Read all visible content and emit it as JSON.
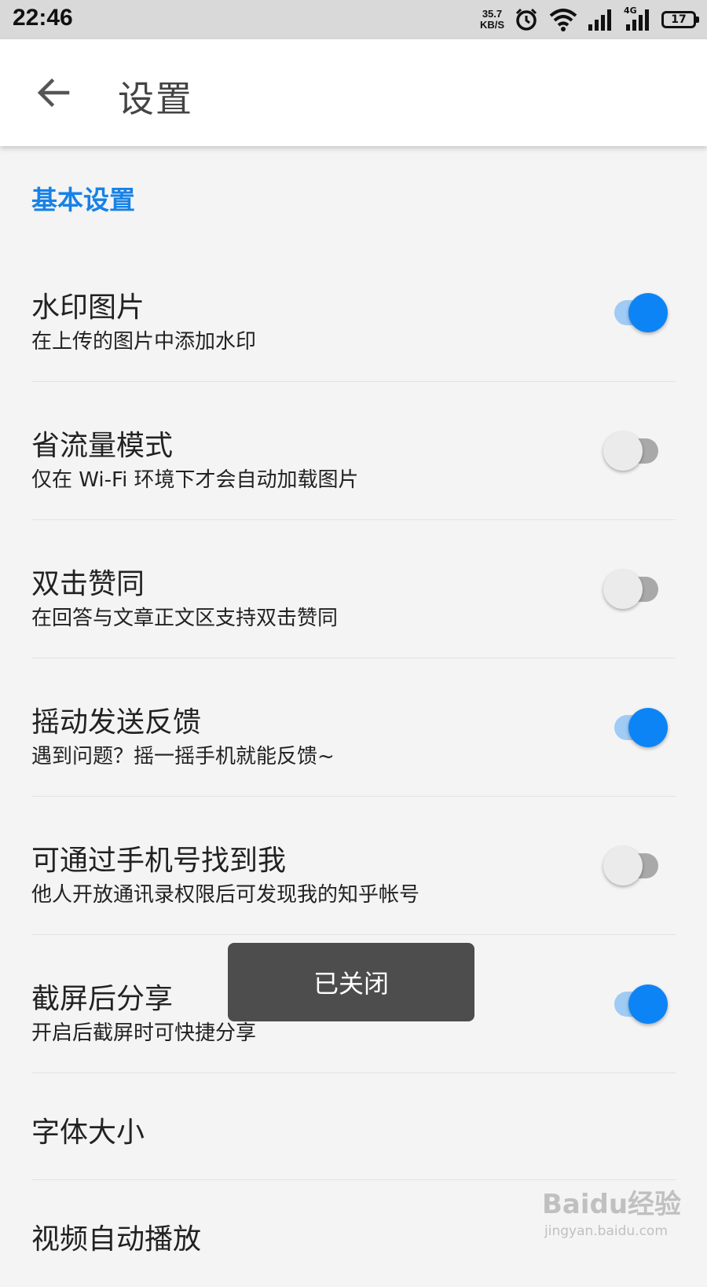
{
  "status_bar": {
    "time": "22:46",
    "net_speed_value": "35.7",
    "net_speed_unit": "KB/S",
    "network_type": "4G",
    "battery_level": "17",
    "icons": [
      "alarm-icon",
      "wifi-icon",
      "signal-icon",
      "signal-4g-icon",
      "battery-icon"
    ]
  },
  "header": {
    "back_icon": "arrow-left-icon",
    "title": "设置"
  },
  "section": {
    "title": "基本设置",
    "accent_color": "#1782e6"
  },
  "settings": [
    {
      "title": "水印图片",
      "description": "在上传的图片中添加水印",
      "enabled": true
    },
    {
      "title": "省流量模式",
      "description": "仅在 Wi-Fi 环境下才会自动加载图片",
      "enabled": false
    },
    {
      "title": "双击赞同",
      "description": "在回答与文章正文区支持双击赞同",
      "enabled": false
    },
    {
      "title": "摇动发送反馈",
      "description": "遇到问题？摇一摇手机就能反馈~",
      "enabled": true
    },
    {
      "title": "可通过手机号找到我",
      "description": "他人开放通讯录权限后可发现我的知乎帐号",
      "enabled": false
    },
    {
      "title": "截屏后分享",
      "description": "开启后截屏时可快捷分享",
      "enabled": true
    },
    {
      "title": "字体大小"
    },
    {
      "title": "视频自动播放"
    }
  ],
  "toast": {
    "message": "已关闭"
  },
  "colors": {
    "toggle_on_thumb": "#0d84f5",
    "toggle_on_track": "#9fcbf5",
    "toggle_off_thumb": "#ebebeb",
    "toggle_off_track": "#a9a9a9"
  },
  "watermark": {
    "logo_text": "Baidu经验",
    "url_text": "jingyan.baidu.com"
  }
}
